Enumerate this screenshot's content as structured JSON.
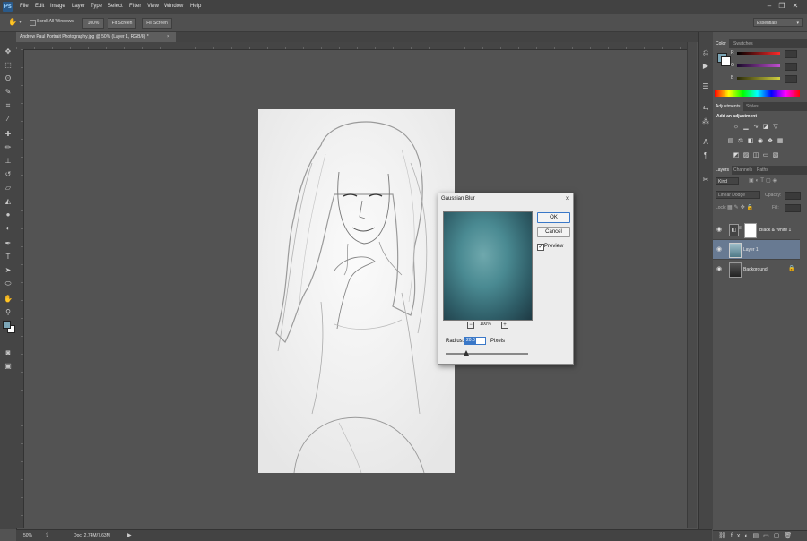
{
  "menubar": {
    "logo": "Ps",
    "items": [
      "File",
      "Edit",
      "Image",
      "Layer",
      "Type",
      "Select",
      "Filter",
      "View",
      "Window",
      "Help"
    ],
    "window_controls": [
      "minimize-icon",
      "restore-icon",
      "close-icon"
    ]
  },
  "options": {
    "scroll_all_label": "Scroll All Windows",
    "zoom_100": "100%",
    "fit_screen": "Fit Screen",
    "fill_screen": "Fill Screen",
    "workspace": "Essentials"
  },
  "document": {
    "tab_title": "Andrew Paul Portrait Photography.jpg @ 50% (Layer 1, RGB/8) *",
    "tab_close": "×"
  },
  "status": {
    "zoom": "50%",
    "doc_info": "Doc: 2.74M/7.63M"
  },
  "dialog": {
    "title": "Gaussian Blur",
    "close": "×",
    "ok": "OK",
    "cancel": "Cancel",
    "preview_label": "Preview",
    "preview_checked": true,
    "zoom": "100%",
    "radius_label": "Radius:",
    "radius_value": "20.0",
    "radius_unit": "Pixels",
    "slider_position": 0.25
  },
  "color_panel": {
    "tabs": [
      "Color",
      "Swatches"
    ],
    "channels": [
      "R",
      "G",
      "B"
    ],
    "values": [
      "0",
      "0",
      "0"
    ]
  },
  "adjustments_panel": {
    "tabs": [
      "Adjustments",
      "Styles"
    ],
    "heading": "Add an adjustment"
  },
  "layers_panel": {
    "tabs": [
      "Layers",
      "Channels",
      "Paths"
    ],
    "filter_label": "Kind",
    "blend_mode": "Linear Dodge",
    "opacity_label": "Opacity:",
    "lock_label": "Lock:",
    "fill_label": "Fill:",
    "layers": [
      {
        "name": "Black & White 1",
        "selected": false
      },
      {
        "name": "Layer 1",
        "selected": true
      },
      {
        "name": "Background",
        "selected": false
      }
    ]
  },
  "colors": {
    "accent": "#3a78c8",
    "selected_layer": "#687a92",
    "foreground_swatch": "#7da7b8",
    "background_swatch": "#ffffff"
  }
}
